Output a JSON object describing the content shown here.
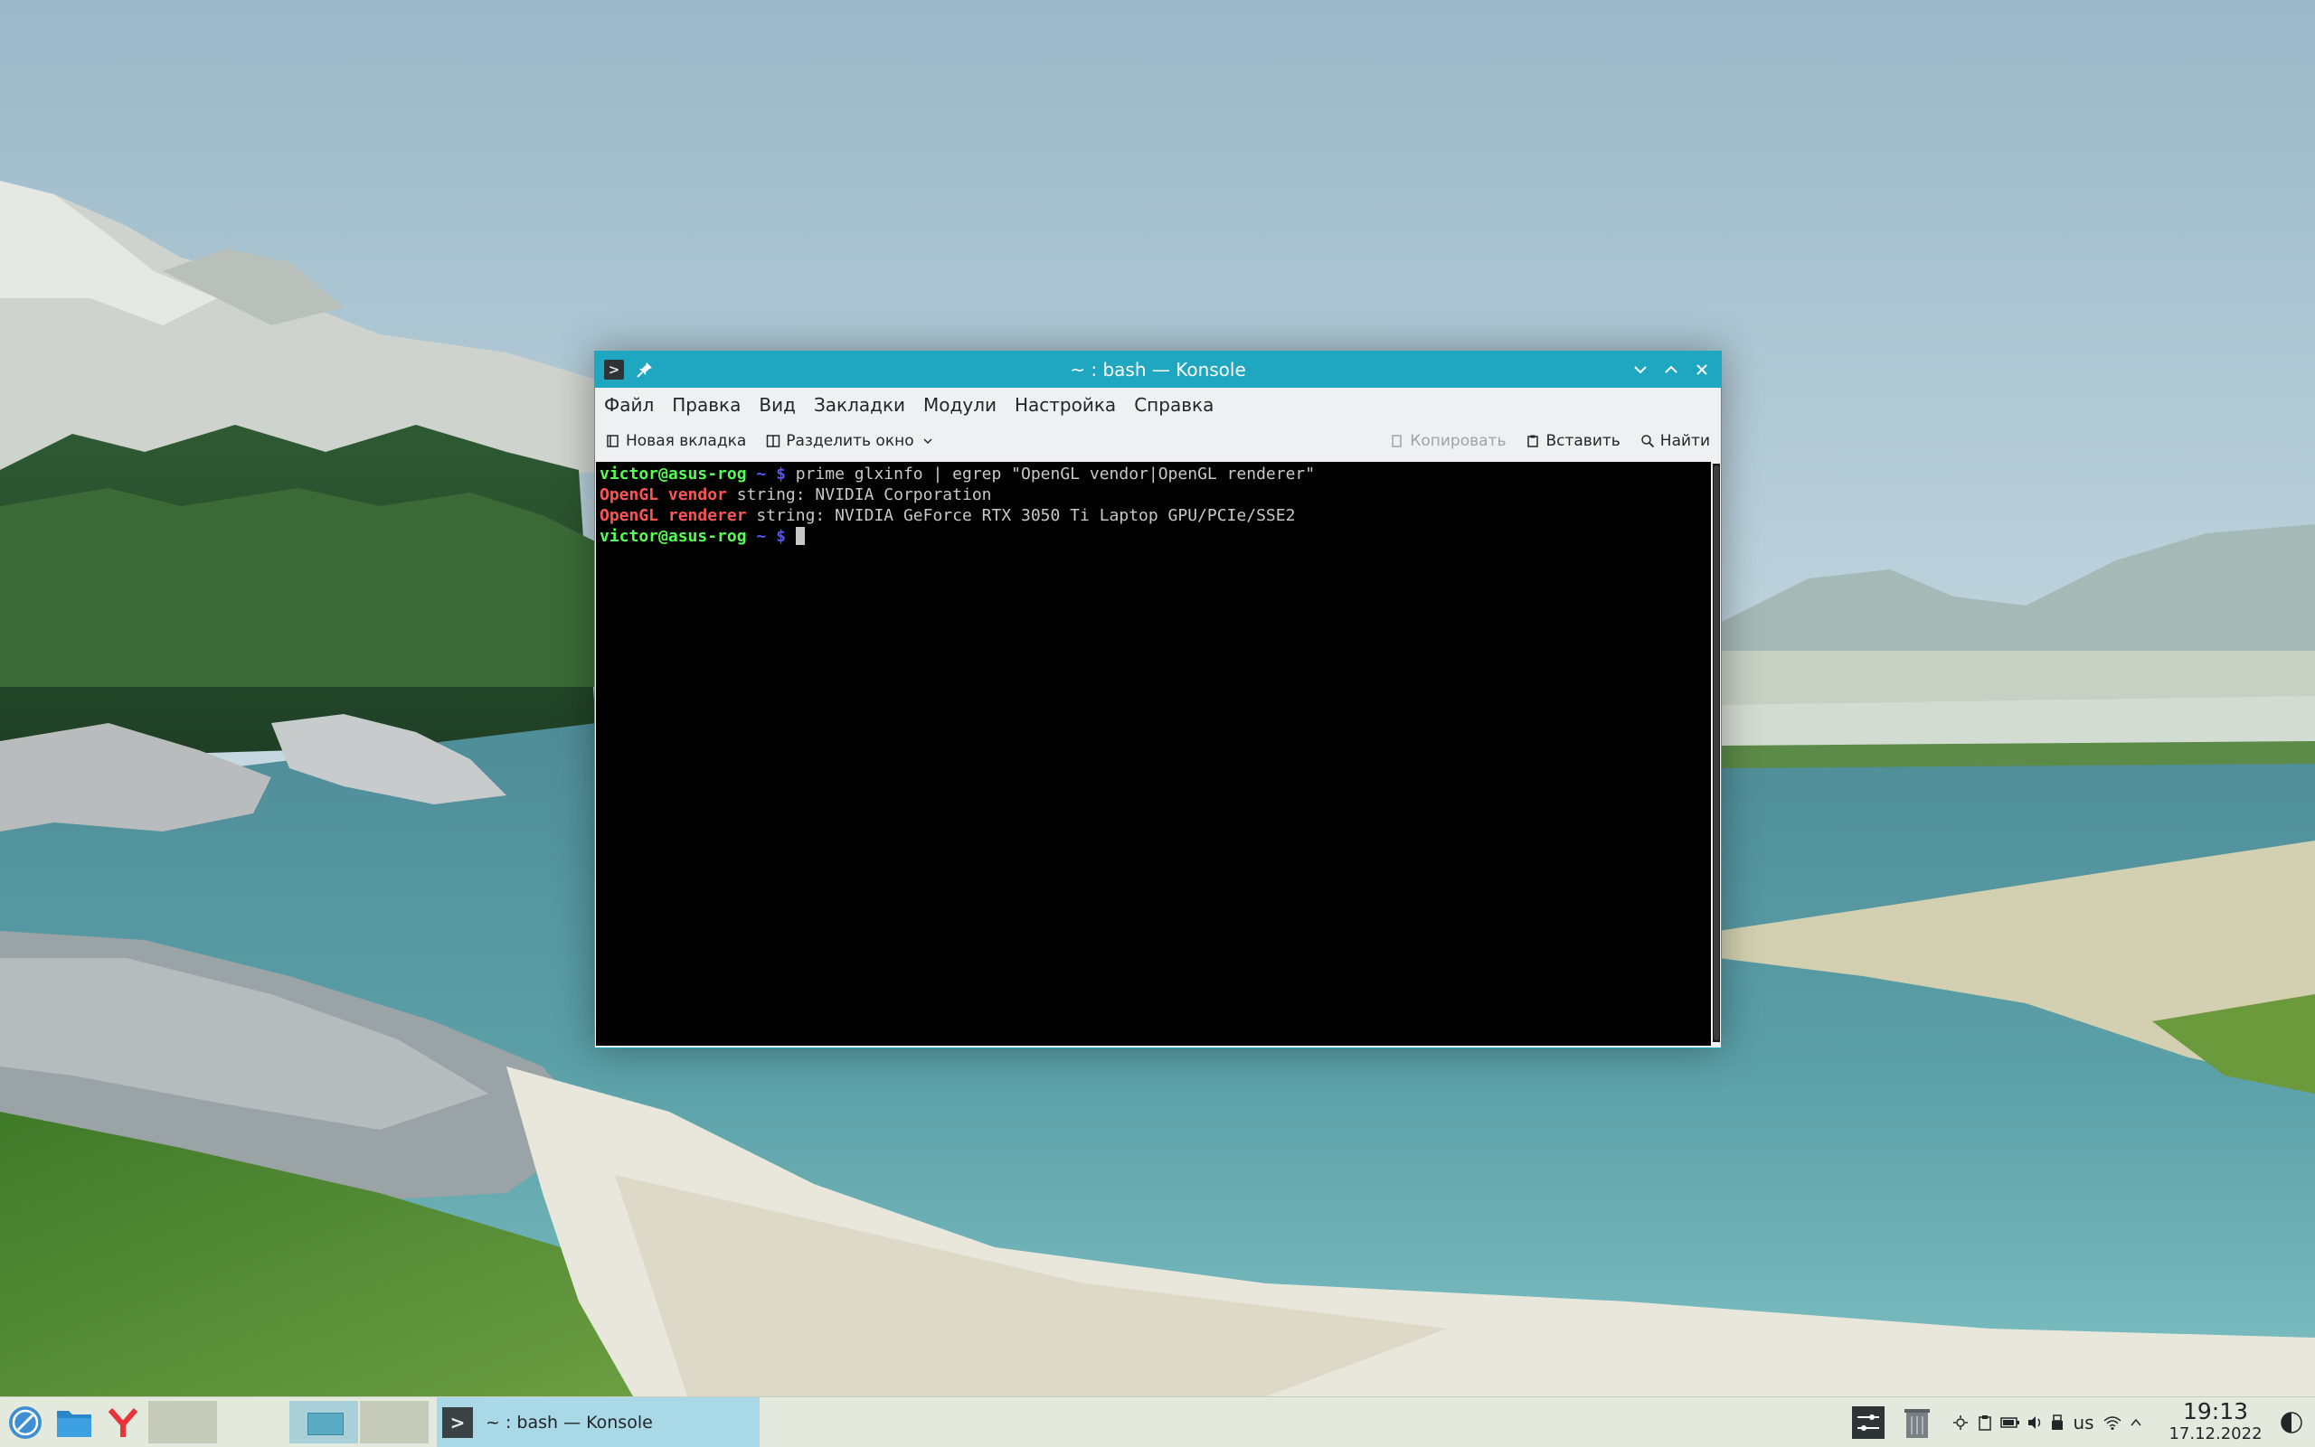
{
  "window": {
    "title": "~ : bash — Konsole",
    "menu": [
      "Файл",
      "Правка",
      "Вид",
      "Закладки",
      "Модули",
      "Настройка",
      "Справка"
    ],
    "toolbar": {
      "new_tab": "Новая вкладка",
      "split_view": "Разделить окно",
      "copy": "Копировать",
      "paste": "Вставить",
      "find": "Найти"
    }
  },
  "terminal": {
    "line1": {
      "prompt": "victor@asus-rog",
      "tilde": " ~ $ ",
      "command": "prime glxinfo | egrep \"OpenGL vendor|OpenGL renderer\""
    },
    "line2": {
      "key": "OpenGL vendor",
      "rest": " string: NVIDIA Corporation"
    },
    "line3": {
      "key": "OpenGL renderer",
      "rest": " string: NVIDIA GeForce RTX 3050 Ti Laptop GPU/PCIe/SSE2"
    },
    "line4": {
      "prompt": "victor@asus-rog",
      "tilde": " ~ $ "
    }
  },
  "taskbar": {
    "task_label": "~ : bash — Konsole",
    "keyboard_layout": "us",
    "time": "19:13",
    "date": "17.12.2022"
  },
  "icons": {
    "app_menu": "launcher-icon",
    "files": "folder-icon",
    "browser": "yandex-browser-icon",
    "terminal": "terminal-icon"
  },
  "colors": {
    "titlebar": "#1fa6c0",
    "task_active": "#a9d8e6",
    "prompt": "#54ff54",
    "tilde": "#5454ff",
    "highlight": "#ff5454"
  }
}
